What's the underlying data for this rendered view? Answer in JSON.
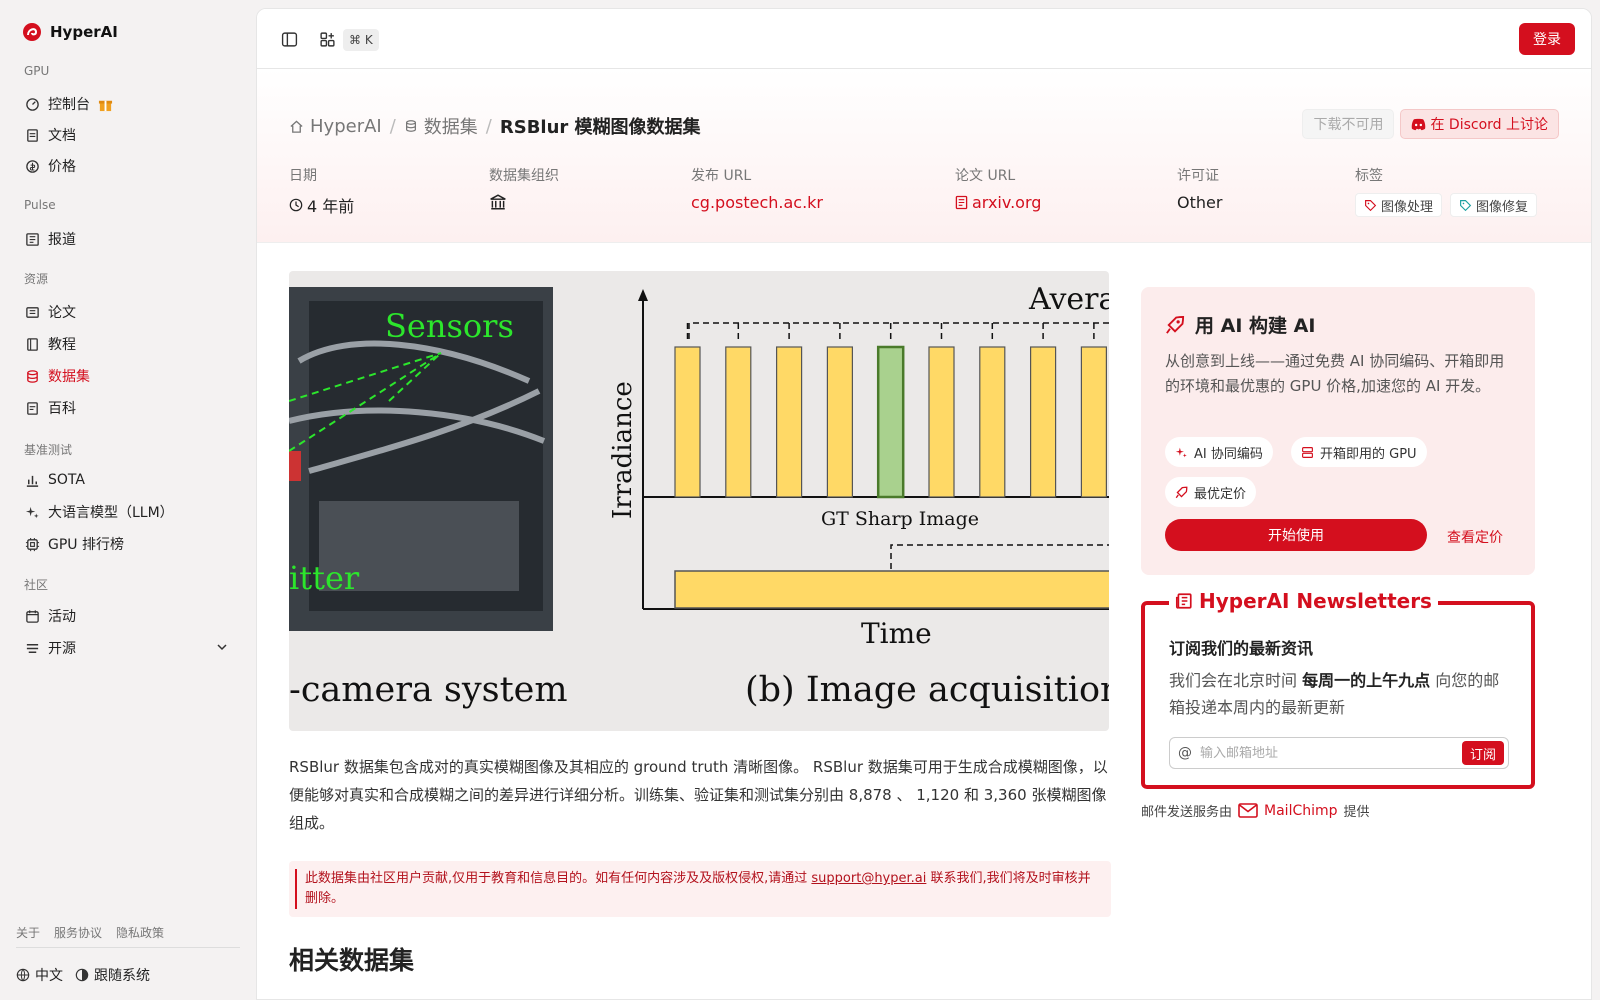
{
  "brand": {
    "name": "HyperAI"
  },
  "sidebar": {
    "sections": [
      {
        "title": "GPU",
        "items": [
          {
            "label": "控制台",
            "icon": "dashboard-icon"
          },
          {
            "label": "文档",
            "icon": "doc-icon"
          },
          {
            "label": "价格",
            "icon": "price-icon"
          }
        ]
      },
      {
        "title": "Pulse",
        "items": [
          {
            "label": "报道",
            "icon": "news-icon"
          }
        ]
      },
      {
        "title": "资源",
        "items": [
          {
            "label": "论文",
            "icon": "paper-icon"
          },
          {
            "label": "教程",
            "icon": "book-icon"
          },
          {
            "label": "数据集",
            "icon": "database-icon",
            "active": true
          },
          {
            "label": "百科",
            "icon": "wiki-icon"
          }
        ]
      },
      {
        "title": "基准测试",
        "items": [
          {
            "label": "SOTA",
            "icon": "chart-icon"
          },
          {
            "label": "大语言模型（LLM）",
            "icon": "sparkle-icon"
          },
          {
            "label": "GPU 排行榜",
            "icon": "chip-icon"
          }
        ]
      },
      {
        "title": "社区",
        "items": [
          {
            "label": "活动",
            "icon": "calendar-icon"
          },
          {
            "label": "开源",
            "icon": "list-icon"
          }
        ]
      }
    ],
    "footer_links": [
      "关于",
      "服务协议",
      "隐私政策"
    ],
    "language": "中文",
    "theme": "跟随系统"
  },
  "topbar": {
    "shortcut": "⌘ K",
    "login": "登录"
  },
  "breadcrumb": {
    "home": "HyperAI",
    "section": "数据集",
    "current": "RSBlur 模糊图像数据集"
  },
  "hero_buttons": {
    "download": "下载不可用",
    "discord": "在 Discord 上讨论"
  },
  "meta": {
    "date_label": "日期",
    "date_value": "4 年前",
    "org_label": "数据集组织",
    "release_label": "发布 URL",
    "release_value": "cg.postech.ac.kr",
    "paper_label": "论文 URL",
    "paper_value": "arxiv.org",
    "license_label": "许可证",
    "license_value": "Other",
    "tags_label": "标签",
    "tags": [
      "图像处理",
      "图像修复"
    ]
  },
  "figure": {
    "sensors": "Sensors",
    "splitter": "itter",
    "average": "Averag",
    "irradiance": "Irradiance",
    "gt": "GT Sharp Image",
    "time": "Time",
    "caption_a": "-camera system",
    "caption_b": "(b) Image acquisition pro"
  },
  "description": "RSBlur 数据集包含成对的真实模糊图像及其相应的 ground truth 清晰图像。 RSBlur 数据集可用于生成合成模糊图像，以便能够对真实和合成模糊之间的差异进行详细分析。训练集、验证集和测试集分别由 8,878 、 1,120 和 3,360 张模糊图像组成。",
  "notice": {
    "before": "此数据集由社区用户贡献,仅用于教育和信息目的。如有任何内容涉及及版权侵权,请通过 ",
    "email": "support@hyper.ai",
    "after": " 联系我们,我们将及时审核并删除。"
  },
  "related_title": "相关数据集",
  "promo": {
    "title": "用 AI 构建 AI",
    "desc": "从创意到上线——通过免费 AI 协同编码、开箱即用的环境和最优惠的 GPU 价格,加速您的 AI 开发。",
    "chips": [
      "AI 协同编码",
      "开箱即用的 GPU",
      "最优定价"
    ],
    "start": "开始使用",
    "pricing": "查看定价"
  },
  "newsletter": {
    "title": "HyperAI Newsletters",
    "subtitle": "订阅我们的最新资讯",
    "desc_before": "我们会在北京时间 ",
    "desc_bold": "每周一的上午九点",
    "desc_after": " 向您的邮箱投递本周内的最新更新",
    "placeholder": "输入邮箱地址",
    "subscribe": "订阅"
  },
  "provided": {
    "before": "邮件发送服务由",
    "brand": "MailChimp",
    "after": "提供"
  },
  "colors": {
    "accent": "#d40f1e",
    "bar_yellow": "#ffd966",
    "bar_green": "#a9d18e"
  }
}
